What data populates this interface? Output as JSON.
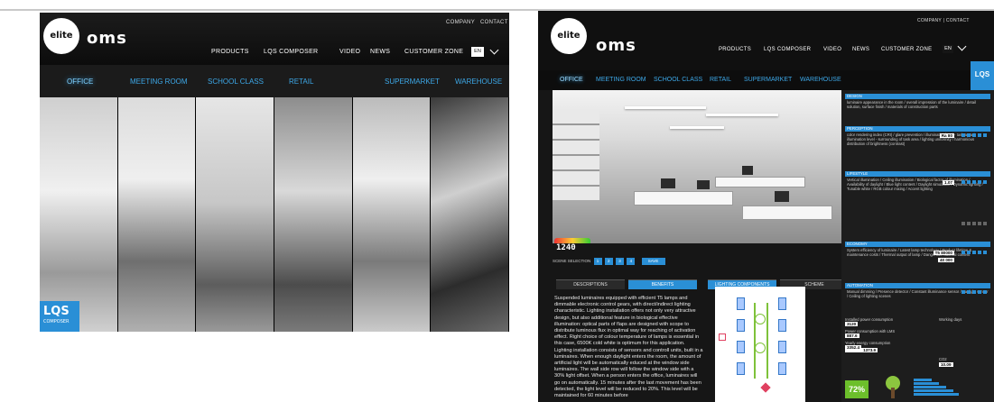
{
  "left": {
    "logo_text": "elite",
    "brand": "oms",
    "top_links": [
      "COMPANY",
      "CONTACT"
    ],
    "nav": [
      "PRODUCTS",
      "LQS COMPOSER",
      "VIDEO",
      "NEWS",
      "CUSTOMER ZONE"
    ],
    "lang": "EN",
    "tabs": [
      "OFFICE",
      "MEETING ROOM",
      "SCHOOL CLASS",
      "RETAIL",
      "SUPERMARKET",
      "WAREHOUSE"
    ],
    "badge": "LQS",
    "badge_sub": "COMPOSER"
  },
  "right": {
    "logo_text": "elite",
    "brand": "oms",
    "top_links": "COMPANY | CONTACT",
    "nav": [
      "PRODUCTS",
      "LQS COMPOSER",
      "VIDEO",
      "NEWS",
      "CUSTOMER ZONE"
    ],
    "lang": "EN",
    "tabs": [
      "OFFICE",
      "MEETING ROOM",
      "SCHOOL CLASS",
      "RETAIL",
      "SUPERMARKET",
      "WAREHOUSE"
    ],
    "badge": "LQS",
    "counter": "1240",
    "scene_label": "SCENE SELECTION",
    "scene_numbers": [
      "1",
      "2",
      "3",
      "4"
    ],
    "scene_save": "SAVE",
    "buttons": [
      "DESCRIPTIONS",
      "BENEFITS",
      "LIGHTING COMPONENTS",
      "SCHEME"
    ],
    "description": "Suspended luminaires equipped with efficient T5 lamps and dimmable electronic control gears, with direct/indirect lighting characteristic. Lighting installation offers not only very attractive design, but also additional feature in biological effective illumination: optical parts of flaps are designed with scope to distribute luminous flux in optimal way for reaching of activation effect. Right choice of colour temperature of lamps is essential in this case, 6500K cold white is optimum for this application. Lighting installation consists of sensors and controll units, built in a luminaires. When enough daylight enters the room, the amount of artificial light will be automatically educed at the window side luminaires. The wall side row will follow the window side with a 30% light offset. When a person enters the office, luminaires will go on automatically. 15 minutes after the last movement has been detected, the light level will be reduced to 20%. This level will be maintained for 60 minutes before",
    "panel": {
      "design_title": "DESIGN",
      "design_text": "luminaire appearance in the room / overall impression of the luminaire / detail solution, surface finish / materials of construction parts",
      "perception_title": "PERCEPTION",
      "perception_text": "color rendering index (CRI) / glare prevention / illumination level - task area / illumination level - surrounding of task area / lighting uniformity / harmonious distribution of brightness (contrast)",
      "perception_value": "Ra 80",
      "lifestyle_title": "LIFESTYLE",
      "lifestyle_text": "Vertical illumination / Ceiling illumination / Biological factor of illumination / Availability of daylight / Blue light content / Daylight simulation / Dynamic lighting / Tunable white / RGB colour mixing / Accent lighting",
      "lifestyle_value": "1.07",
      "economy_title": "ECONOMY",
      "economy_text": "System efficiency of luminaire / Latest lamp technology / Product lifetime & maintenance costs / Thermal output of lamp / Dangerous material content",
      "economy_values": [
        "T5 80000",
        "40 000"
      ],
      "automation_title": "AUTOMATION",
      "automation_text": "Manual dimming / Presence detector / Constant illuminance sensor / Daylight sensor / Ceiling of lighting scenes",
      "energy_labels": [
        "Installed power consumption",
        "Power consumption with LMS",
        "Yearly energy consumption",
        "CO2"
      ],
      "energy_values": [
        "3120",
        "887.6",
        "3352.4",
        "1373.9",
        "10.09"
      ],
      "working_days": "Working days",
      "percent": "72%"
    }
  }
}
